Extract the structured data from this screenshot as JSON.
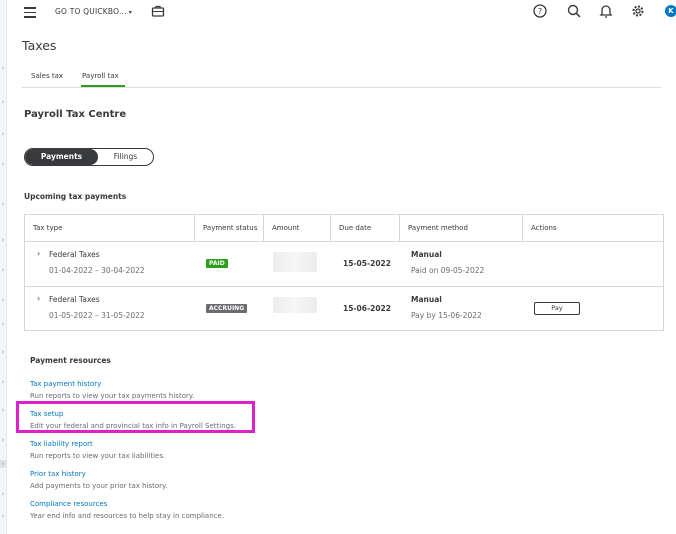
{
  "topbar": {
    "goto_label": "GO TO QUICKBO...",
    "icons": [
      "menu-icon",
      "briefcase-icon",
      "help-icon",
      "search-icon",
      "bell-icon",
      "gear-icon"
    ],
    "avatar_letter": "K"
  },
  "page": {
    "title": "Taxes"
  },
  "tabs": [
    {
      "label": "Sales tax",
      "active": false
    },
    {
      "label": "Payroll tax",
      "active": true
    }
  ],
  "section": {
    "title": "Payroll Tax Centre"
  },
  "segmented": {
    "payments": "Payments",
    "filings": "Filings"
  },
  "upcoming": {
    "title": "Upcoming tax payments",
    "columns": [
      "Tax type",
      "Payment status",
      "Amount",
      "Due date",
      "Payment method",
      "Actions"
    ],
    "rows": [
      {
        "tax_type": "Federal Taxes",
        "period": "01-04-2022 – 30-04-2022",
        "status": "PAID",
        "status_color": "#2ca01c",
        "due_date": "15-05-2022",
        "method": "Manual",
        "method_detail": "Paid on 09-05-2022",
        "action": ""
      },
      {
        "tax_type": "Federal Taxes",
        "period": "01-05-2022 – 31-05-2022",
        "status": "ACCRUING",
        "status_color": "#6b6c72",
        "due_date": "15-06-2022",
        "method": "Manual",
        "method_detail": "Pay by 15-06-2022",
        "action": "Pay"
      }
    ]
  },
  "resources": {
    "title": "Payment resources",
    "items": [
      {
        "link": "Tax payment history",
        "desc": "Run reports to view your tax payments history."
      },
      {
        "link": "Tax setup",
        "desc": "Edit your federal and provincial tax info in Payroll Settings."
      },
      {
        "link": "Tax liability report",
        "desc": "Run reports to view your tax liabilities."
      },
      {
        "link": "Prior tax history",
        "desc": "Add payments to your prior tax history."
      },
      {
        "link": "Compliance resources",
        "desc": "Year end info and resources to help stay in compliance."
      }
    ]
  },
  "colors": {
    "accent_green": "#2ca01c",
    "link_blue": "#0077c5",
    "highlight": "#e020c8"
  }
}
